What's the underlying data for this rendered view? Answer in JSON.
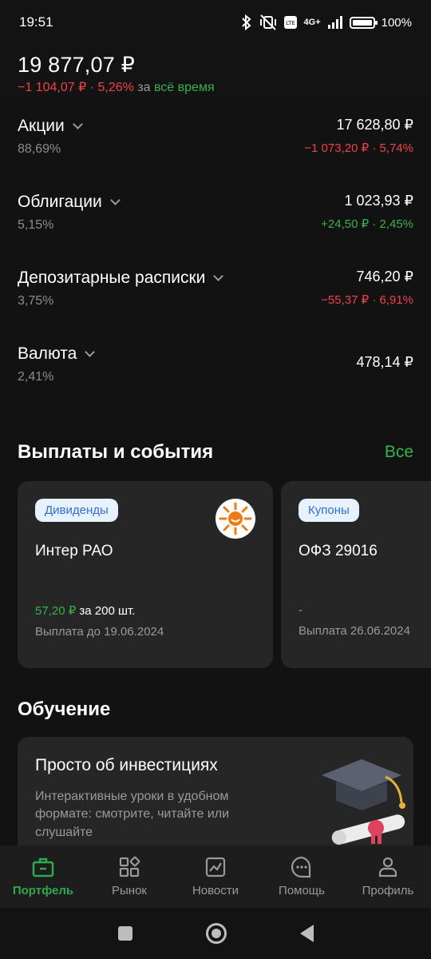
{
  "status_bar": {
    "time": "19:51",
    "network": "4G+",
    "battery": "100%",
    "icons": [
      "bluetooth-icon",
      "vibrate-off-icon",
      "volte-icon",
      "signal-icon",
      "battery-icon"
    ]
  },
  "portfolio": {
    "total": "19 877,07 ₽",
    "change": "−1 104,07 ₽ · 5,26%",
    "change_prefix": "за",
    "period": "всё время"
  },
  "assets": [
    {
      "name": "Акции",
      "share": "88,69%",
      "value": "17 628,80 ₽",
      "change": "−1 073,20 ₽ · 5,74%",
      "trend": "negative"
    },
    {
      "name": "Облигации",
      "share": "5,15%",
      "value": "1 023,93 ₽",
      "change": "+24,50 ₽ · 2,45%",
      "trend": "positive"
    },
    {
      "name": "Депозитарные расписки",
      "share": "3,75%",
      "value": "746,20 ₽",
      "change": "−55,37 ₽ · 6,91%",
      "trend": "negative"
    },
    {
      "name": "Валюта",
      "share": "2,41%",
      "value": "478,14 ₽",
      "change": "",
      "trend": "none"
    }
  ],
  "events": {
    "title": "Выплаты и события",
    "all_link": "Все",
    "cards": [
      {
        "tag": "Дивиденды",
        "name": "Интер РАО",
        "amount": "57,20 ₽",
        "amount_suffix": "за 200 шт.",
        "date": "Выплата до 19.06.2024"
      },
      {
        "tag": "Купоны",
        "name": "ОФЗ 29016",
        "amount": "-",
        "amount_suffix": "",
        "date": "Выплата 26.06.2024"
      }
    ]
  },
  "learning": {
    "title": "Обучение",
    "card": {
      "title": "Просто об инвестициях",
      "description": "Интерактивные уроки в удобном формате: смотрите, читайте или слушайте"
    }
  },
  "tabs": [
    {
      "label": "Портфель",
      "icon": "briefcase-icon",
      "active": true
    },
    {
      "label": "Рынок",
      "icon": "market-grid-icon",
      "active": false
    },
    {
      "label": "Новости",
      "icon": "news-chart-icon",
      "active": false
    },
    {
      "label": "Помощь",
      "icon": "chat-help-icon",
      "active": false
    },
    {
      "label": "Профиль",
      "icon": "profile-icon",
      "active": false
    }
  ],
  "colors": {
    "accent": "#2fa84f",
    "negative": "#f0424a",
    "positive": "#37b24d",
    "background": "#131313",
    "card": "#262626",
    "chip_text": "#2e6fd1"
  }
}
